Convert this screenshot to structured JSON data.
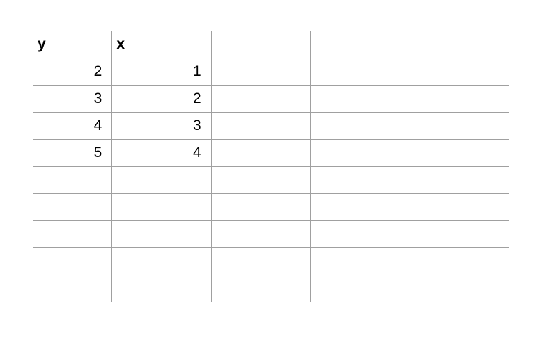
{
  "table": {
    "headers": {
      "col0": "y",
      "col1": "x"
    },
    "rows": [
      {
        "col0": "2",
        "col1": "1"
      },
      {
        "col0": "3",
        "col1": "2"
      },
      {
        "col0": "4",
        "col1": "3"
      },
      {
        "col0": "5",
        "col1": "4"
      }
    ]
  }
}
